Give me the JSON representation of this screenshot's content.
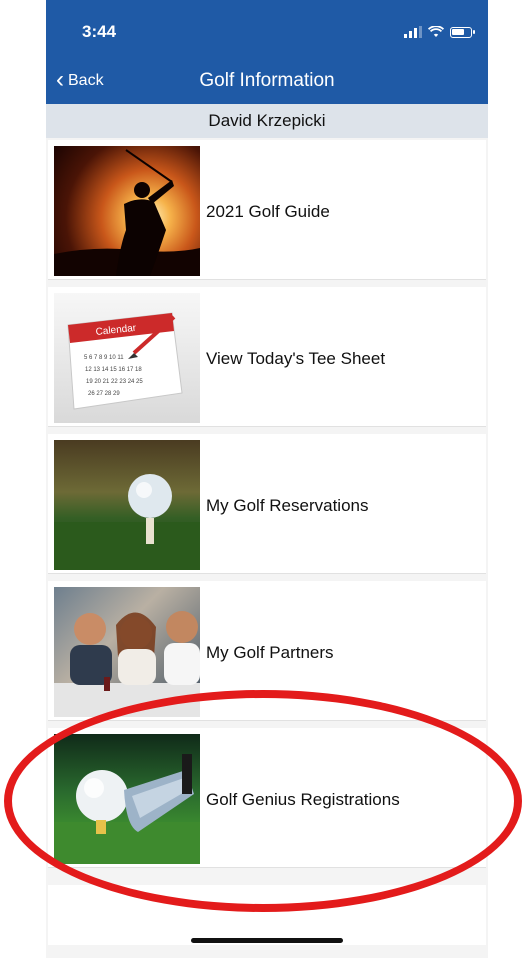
{
  "status_bar": {
    "time": "3:44"
  },
  "nav": {
    "back_label": "Back",
    "title": "Golf Information"
  },
  "member": {
    "name": "David Krzepicki"
  },
  "menu": {
    "items": [
      {
        "label": "2021 Golf Guide",
        "thumbnail": "golfer-silhouette-sunset"
      },
      {
        "label": "View Today's Tee Sheet",
        "thumbnail": "calendar",
        "calendar_header": "Calendar"
      },
      {
        "label": "My Golf Reservations",
        "thumbnail": "golf-ball-on-tee"
      },
      {
        "label": "My Golf Partners",
        "thumbnail": "friends-at-table"
      },
      {
        "label": "Golf Genius Registrations",
        "thumbnail": "golf-club-and-ball"
      }
    ]
  },
  "colors": {
    "header": "#1f5aa6",
    "annotation": "#e31b1b"
  }
}
